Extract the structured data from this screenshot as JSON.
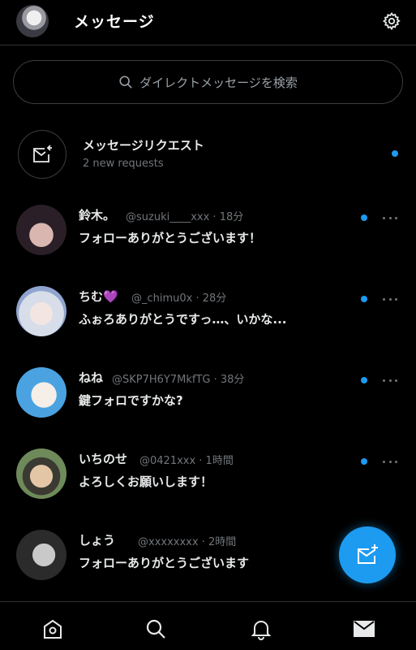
{
  "header": {
    "title": "メッセージ",
    "settings_icon": "gear-icon"
  },
  "search": {
    "placeholder": "ダイレクトメッセージを検索"
  },
  "request": {
    "title": "メッセージリクエスト",
    "subtitle": "2 new requests",
    "unread": true
  },
  "conversations": [
    {
      "name": "鈴木。",
      "handle": "@suzuki____xxx · 18分",
      "preview": "フォローありがとうございます！",
      "unread": true,
      "avatar_colors": [
        "#2a1f26",
        "#d9b7b0"
      ]
    },
    {
      "name": "ちむ💜",
      "handle": "@_chimu0x · 28分",
      "preview": "ふぉろありがとうですっ…、いかな...",
      "unread": true,
      "avatar_colors": [
        "#d7dde9",
        "#8fa5cf"
      ]
    },
    {
      "name": "ねね",
      "handle": "@SKP7H6Y7MkfTG · 38分",
      "preview": "鍵フォロですかな?",
      "unread": true,
      "avatar_colors": [
        "#4aa3e0",
        "#e6f2fb"
      ]
    },
    {
      "name": "いちのせ",
      "handle": "@0421xxx · 1時間",
      "preview": "よろしくお願いします！",
      "unread": true,
      "avatar_colors": [
        "#6f8a5a",
        "#e2c6a6"
      ]
    },
    {
      "name": "しょう",
      "handle": "@xxxxxxxx · 2時間",
      "preview": "フォローありがとうございます",
      "unread": false,
      "avatar_colors": [
        "#2b2b2b",
        "#c9c9c9"
      ]
    }
  ],
  "fab": {
    "icon": "new-message-icon"
  },
  "nav": [
    {
      "name": "home",
      "icon": "home-icon"
    },
    {
      "name": "search",
      "icon": "search-icon"
    },
    {
      "name": "notifications",
      "icon": "bell-icon"
    },
    {
      "name": "messages",
      "icon": "mail-icon",
      "active": true
    }
  ],
  "colors": {
    "accent": "#1d9bf0",
    "background": "#000000",
    "text": "#e7e9ea",
    "muted": "#71767b",
    "divider": "#2f3336"
  }
}
